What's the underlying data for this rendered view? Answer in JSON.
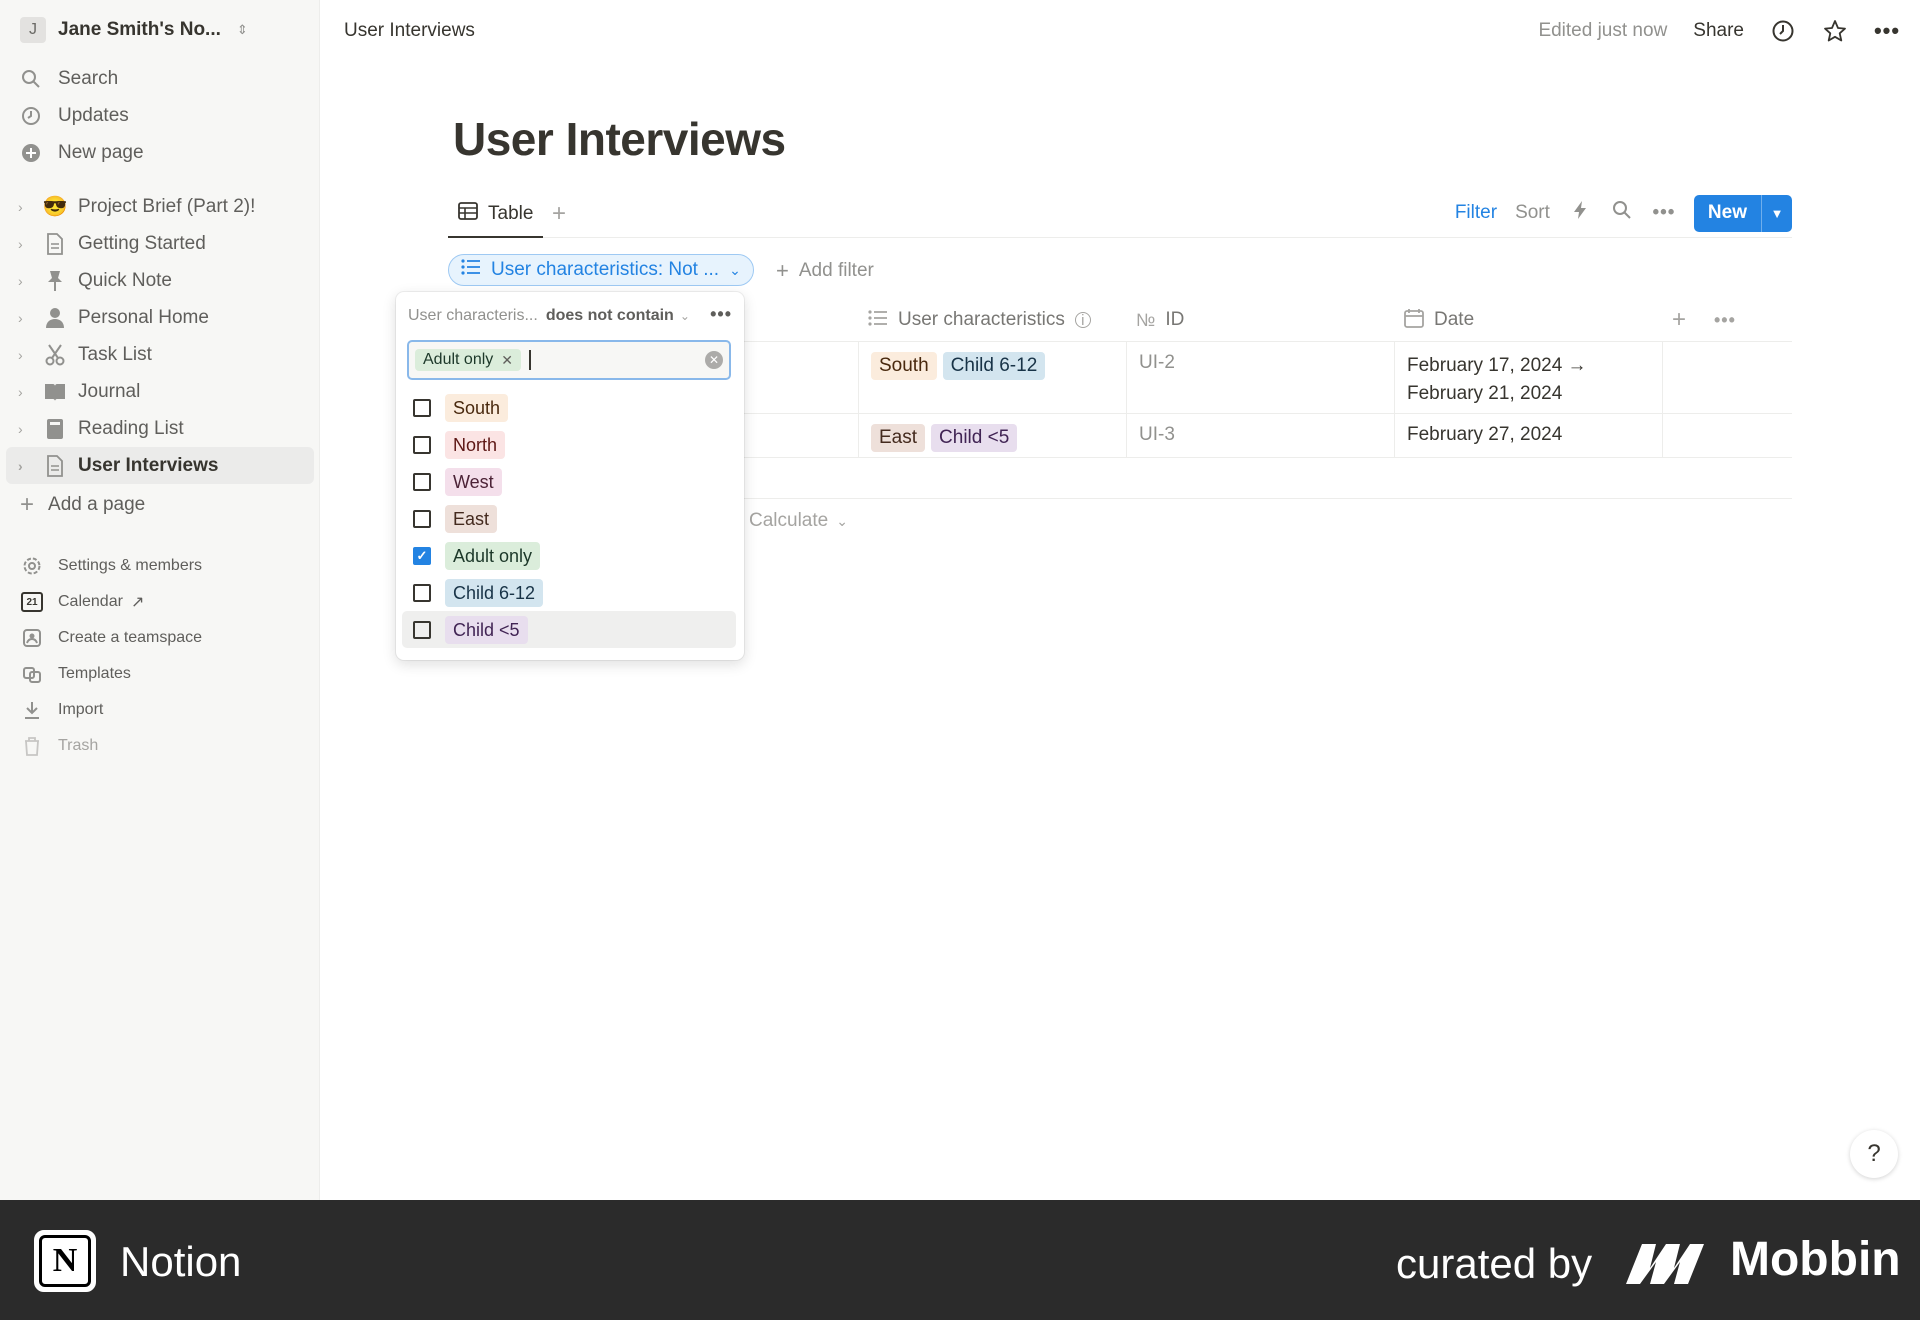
{
  "workspace": {
    "avatar": "J",
    "name": "Jane Smith's No..."
  },
  "sidebar": {
    "top": [
      {
        "label": "Search",
        "icon": "search-icon"
      },
      {
        "label": "Updates",
        "icon": "clock-icon"
      },
      {
        "label": "New page",
        "icon": "plus-circle-icon"
      }
    ],
    "pages": [
      {
        "label": "Project Brief (Part 2)!",
        "icon": "😎"
      },
      {
        "label": "Getting Started",
        "icon": "document-icon"
      },
      {
        "label": "Quick Note",
        "icon": "pin-icon"
      },
      {
        "label": "Personal Home",
        "icon": "person-icon"
      },
      {
        "label": "Task List",
        "icon": "scissors-icon"
      },
      {
        "label": "Journal",
        "icon": "book-icon"
      },
      {
        "label": "Reading List",
        "icon": "book-icon"
      },
      {
        "label": "User Interviews",
        "icon": "document-icon"
      }
    ],
    "add_page": "Add a page",
    "bottom": [
      {
        "label": "Settings & members",
        "icon": "gear-icon"
      },
      {
        "label": "Calendar",
        "icon": "calendar-icon",
        "cal_day": "21"
      },
      {
        "label": "Create a teamspace",
        "icon": "teamspace-icon"
      },
      {
        "label": "Templates",
        "icon": "templates-icon"
      },
      {
        "label": "Import",
        "icon": "download-icon"
      },
      {
        "label": "Trash",
        "icon": "trash-icon"
      }
    ]
  },
  "topbar": {
    "breadcrumb": "User Interviews",
    "edited": "Edited just now",
    "share": "Share"
  },
  "page": {
    "title": "User Interviews"
  },
  "view": {
    "tab": "Table",
    "filter": "Filter",
    "sort": "Sort",
    "new": "New"
  },
  "filters": {
    "active": "User characteristics: Not ...",
    "add": "Add filter"
  },
  "table": {
    "headers": {
      "characteristics": "User characteristics",
      "id": "ID",
      "id_prefix": "№",
      "date": "Date"
    },
    "rows": [
      {
        "tags": [
          "South",
          "Child 6-12"
        ],
        "id": "UI-2",
        "date": "February 17, 2024 →",
        "date2": "February 21, 2024"
      },
      {
        "tags": [
          "East",
          "Child <5"
        ],
        "id": "UI-3",
        "date": "February 27, 2024",
        "date2": ""
      }
    ],
    "calculate": "Calculate"
  },
  "filter_popup": {
    "property": "User characteris...",
    "operator": "does not contain",
    "selected_chip": "Adult only",
    "options": [
      {
        "label": "South",
        "checked": false
      },
      {
        "label": "North",
        "checked": false
      },
      {
        "label": "West",
        "checked": false
      },
      {
        "label": "East",
        "checked": false
      },
      {
        "label": "Adult only",
        "checked": true
      },
      {
        "label": "Child 6-12",
        "checked": false
      },
      {
        "label": "Child <5",
        "checked": false
      }
    ]
  },
  "tag_colors": {
    "South": {
      "bg": "#fbecdd",
      "fg": "#49290e"
    },
    "North": {
      "bg": "#fbe4e4",
      "fg": "#5d1715"
    },
    "West": {
      "bg": "#f4dfeb",
      "fg": "#4c2337"
    },
    "East": {
      "bg": "#eee0da",
      "fg": "#442a1e"
    },
    "Adult only": {
      "bg": "#dbeddb",
      "fg": "#1c3829"
    },
    "Child 6-12": {
      "bg": "#d3e5ef",
      "fg": "#183347"
    },
    "Child <5": {
      "bg": "#e8deee",
      "fg": "#412454"
    }
  },
  "help": "?",
  "footer": {
    "app": "Notion",
    "curated": "curated by",
    "brand": "Mobbin"
  },
  "colors": {
    "accent": "#2383e2"
  }
}
